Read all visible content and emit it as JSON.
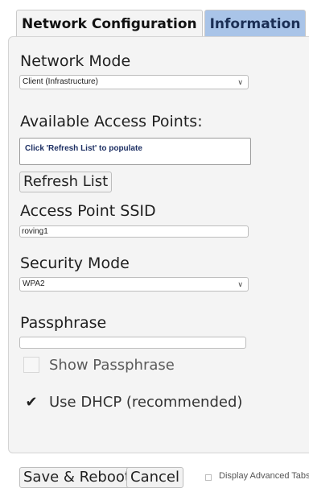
{
  "tabs": [
    {
      "label": "Network Configuration"
    },
    {
      "label": "Information"
    }
  ],
  "network_mode": {
    "label": "Network Mode",
    "value": "Client (Infrastructure)"
  },
  "access_points": {
    "label": "Available Access Points:",
    "placeholder": "Click 'Refresh List' to populate",
    "refresh_label": "Refresh List"
  },
  "ssid": {
    "label": "Access Point SSID",
    "value": "roving1"
  },
  "security": {
    "label": "Security Mode",
    "value": "WPA2"
  },
  "passphrase": {
    "label": "Passphrase",
    "value": ""
  },
  "show_passphrase": {
    "label": "Show Passphrase",
    "checked": false
  },
  "dhcp": {
    "label": "Use DHCP (recommended)",
    "checked": true
  },
  "footer": {
    "save_label": "Save & Reboot",
    "cancel_label": "Cancel",
    "advanced_label": "Display Advanced Tabs"
  },
  "colors": {
    "active_tab_bg": "#f4f4f4",
    "inactive_tab_bg": "#a9c4e8",
    "panel_bg": "#f4f4f4"
  }
}
